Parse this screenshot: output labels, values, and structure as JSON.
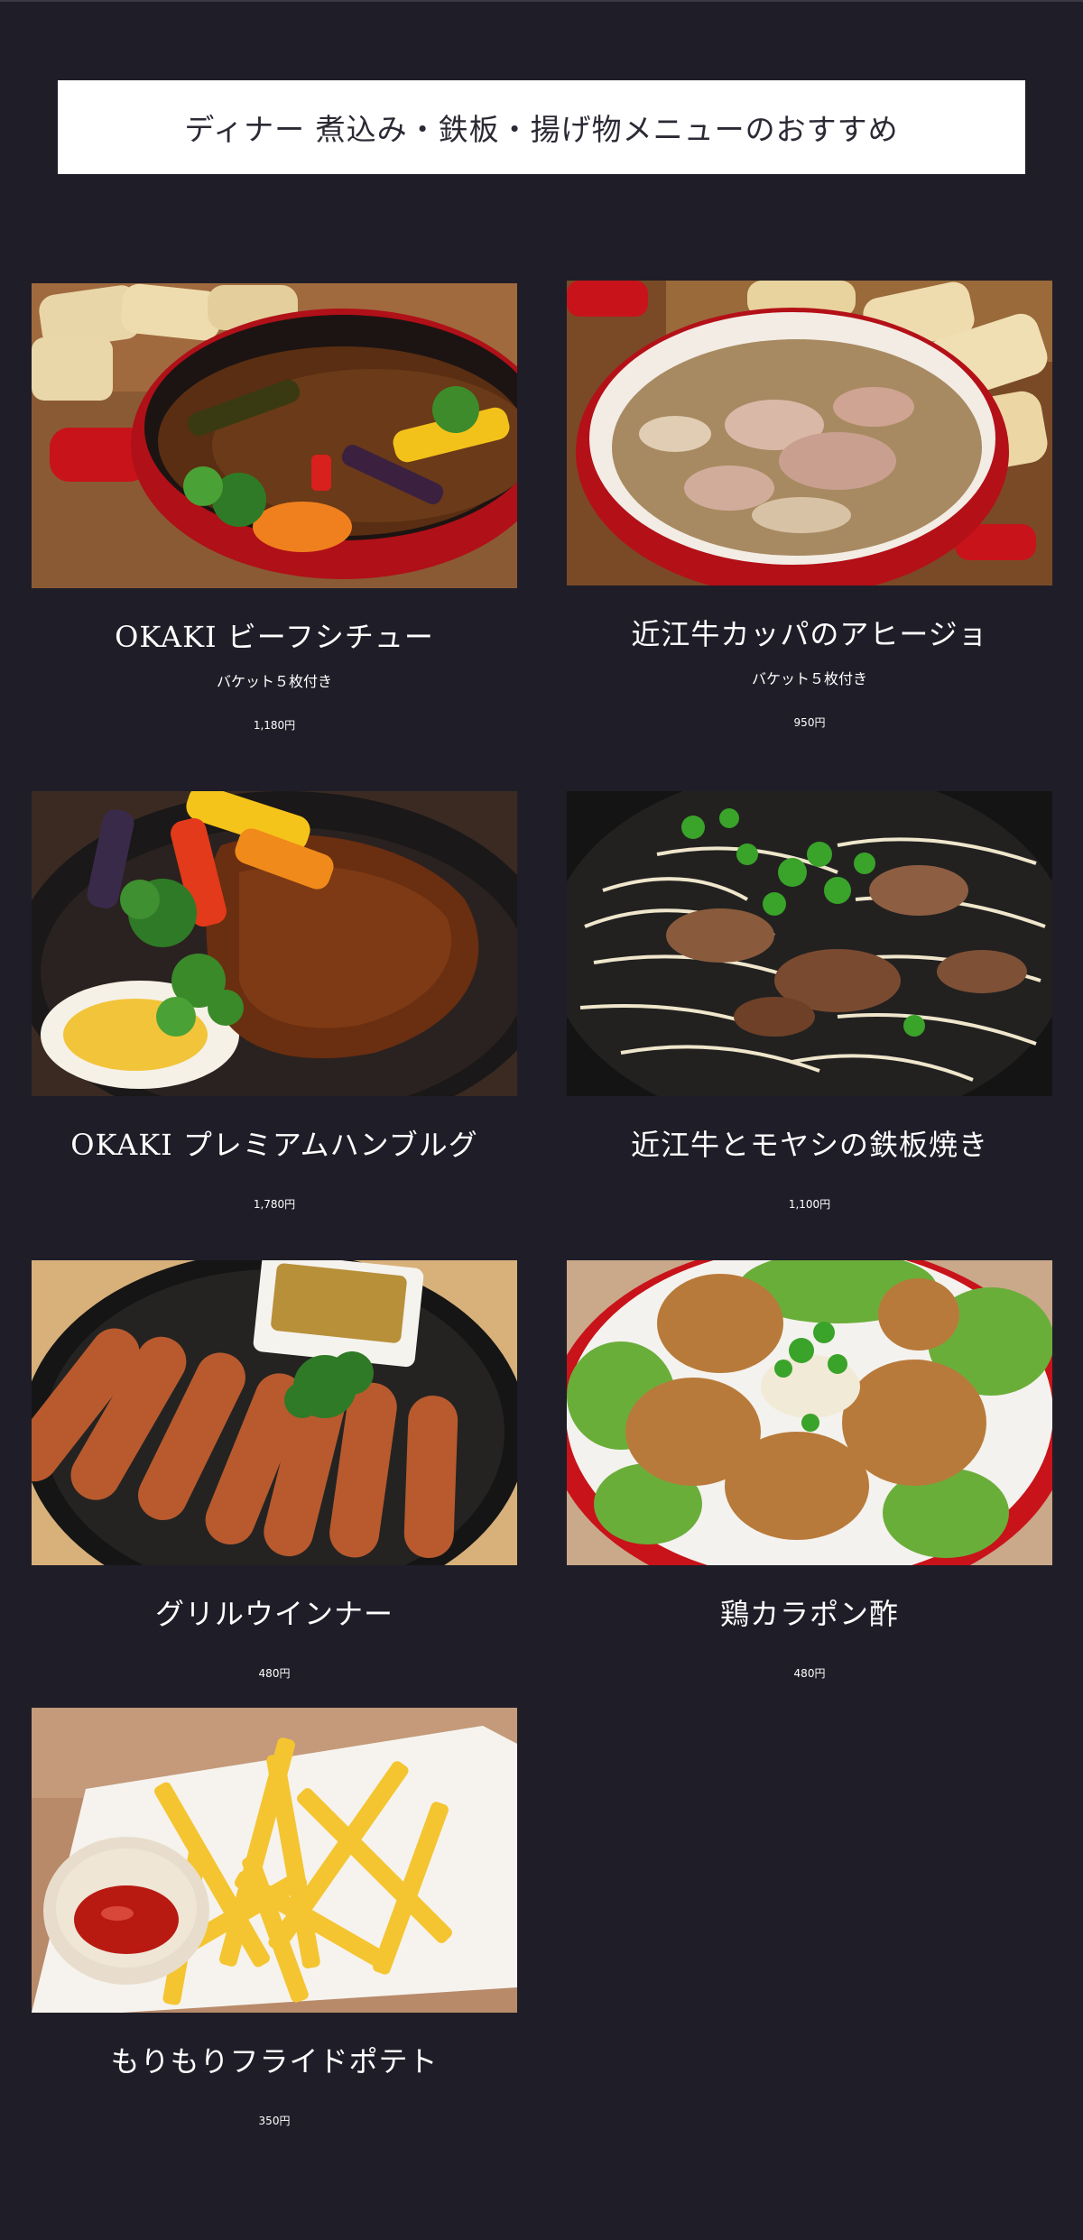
{
  "page": {
    "heading": "ディナー 煮込み・鉄板・揚げ物メニューのおすすめ"
  },
  "menu": [
    {
      "name": "OKAKI ビーフシチュー",
      "note": "バケット５枚付き",
      "price": "1,180円",
      "photo": "beef-stew-photo"
    },
    {
      "name": "近江牛カッパのアヒージョ",
      "note": "バケット５枚付き",
      "price": "950円",
      "photo": "ajillo-photo"
    },
    {
      "name": "OKAKI プレミアムハンブルグ",
      "note": "",
      "price": "1,780円",
      "photo": "hamburg-steak-photo"
    },
    {
      "name": "近江牛とモヤシの鉄板焼き",
      "note": "",
      "price": "1,100円",
      "photo": "beef-sprouts-teppan-photo"
    },
    {
      "name": "グリルウインナー",
      "note": "",
      "price": "480円",
      "photo": "grilled-sausage-photo"
    },
    {
      "name": "鶏カラポン酢",
      "note": "",
      "price": "480円",
      "photo": "fried-chicken-ponzu-photo"
    },
    {
      "name": "もりもりフライドポテト",
      "note": "",
      "price": "350円",
      "photo": "french-fries-photo"
    }
  ],
  "colors": {
    "background": "#1f1e28",
    "heading_box": "#ffffff",
    "heading_text": "#2b2a34",
    "text": "#ffffff"
  }
}
